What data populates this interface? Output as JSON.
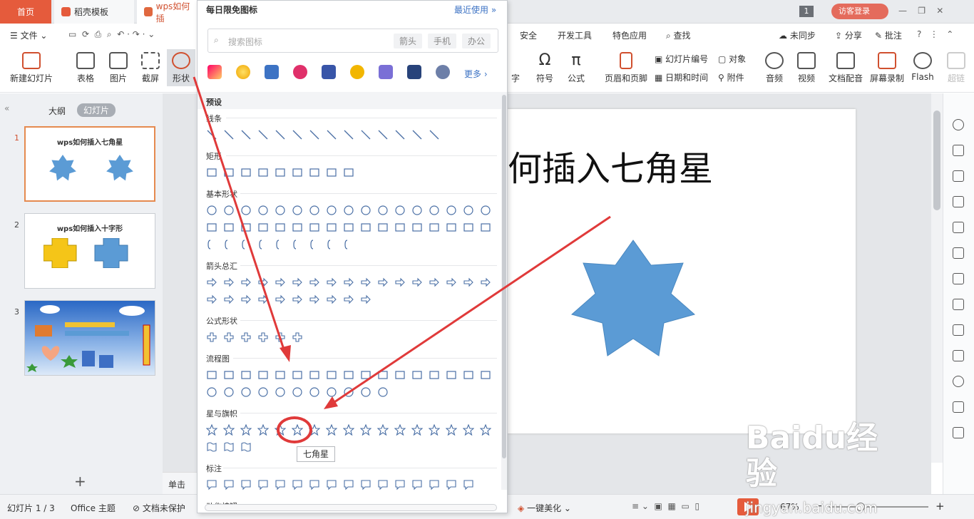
{
  "tabs": {
    "home": "首页",
    "daoke": "稻壳模板",
    "doc": "wps如何插"
  },
  "titlebar": {
    "page_indicator": "1",
    "visitor_login": "访客登录"
  },
  "menubar": {
    "file": "文件",
    "security": "安全",
    "devtools": "开发工具",
    "special_app": "特色应用",
    "search": "查找",
    "sync": "未同步",
    "share": "分享",
    "comment": "批注"
  },
  "ribbon": {
    "new_slide": "新建幻灯片",
    "table": "表格",
    "image": "图片",
    "screenshot": "截屏",
    "shapes": "形状",
    "char": "字",
    "symbol": "符号",
    "formula": "公式",
    "header_footer": "页眉和页脚",
    "slide_number": "幻灯片编号",
    "object": "对象",
    "datetime": "日期和时间",
    "attachment": "附件",
    "audio": "音频",
    "video": "视频",
    "doc_voiceover": "文档配音",
    "screen_record": "屏幕录制",
    "flash": "Flash",
    "super": "超链"
  },
  "left_pane": {
    "outline_tab": "大纲",
    "slides_tab": "幻灯片",
    "slides": [
      {
        "num": "1",
        "title": "wps如何插入七角星"
      },
      {
        "num": "2",
        "title": "wps如何插入十字形"
      },
      {
        "num": "3",
        "title": ""
      }
    ],
    "add": "+"
  },
  "slide": {
    "title": "何插入七角星"
  },
  "notes_label": "单击",
  "statusbar": {
    "slide_counter": "幻灯片 1 / 3",
    "theme": "Office 主题",
    "protect": "文档未保护",
    "beautify": "一键美化",
    "zoom": "67%"
  },
  "shapes_panel": {
    "daily_free": "每日限免图标",
    "recent": "最近使用",
    "search_placeholder": "搜索图标",
    "chips": [
      "箭头",
      "手机",
      "办公"
    ],
    "more": "更多",
    "preset": "预设",
    "sections": {
      "lines": "线条",
      "rect": "矩形",
      "basic": "基本形状",
      "arrows": "箭头总汇",
      "formula": "公式形状",
      "flowchart": "流程图",
      "stars": "星与旗帜",
      "callouts": "标注",
      "actions": "动作按钮"
    }
  },
  "tooltip": "七角星",
  "watermark": {
    "brand": "Baidu经验",
    "url": "jingyan.baidu.com"
  },
  "colors": {
    "accent": "#e55b3c",
    "shape_fill": "#5b9bd5",
    "annotation": "#e03a3a"
  }
}
